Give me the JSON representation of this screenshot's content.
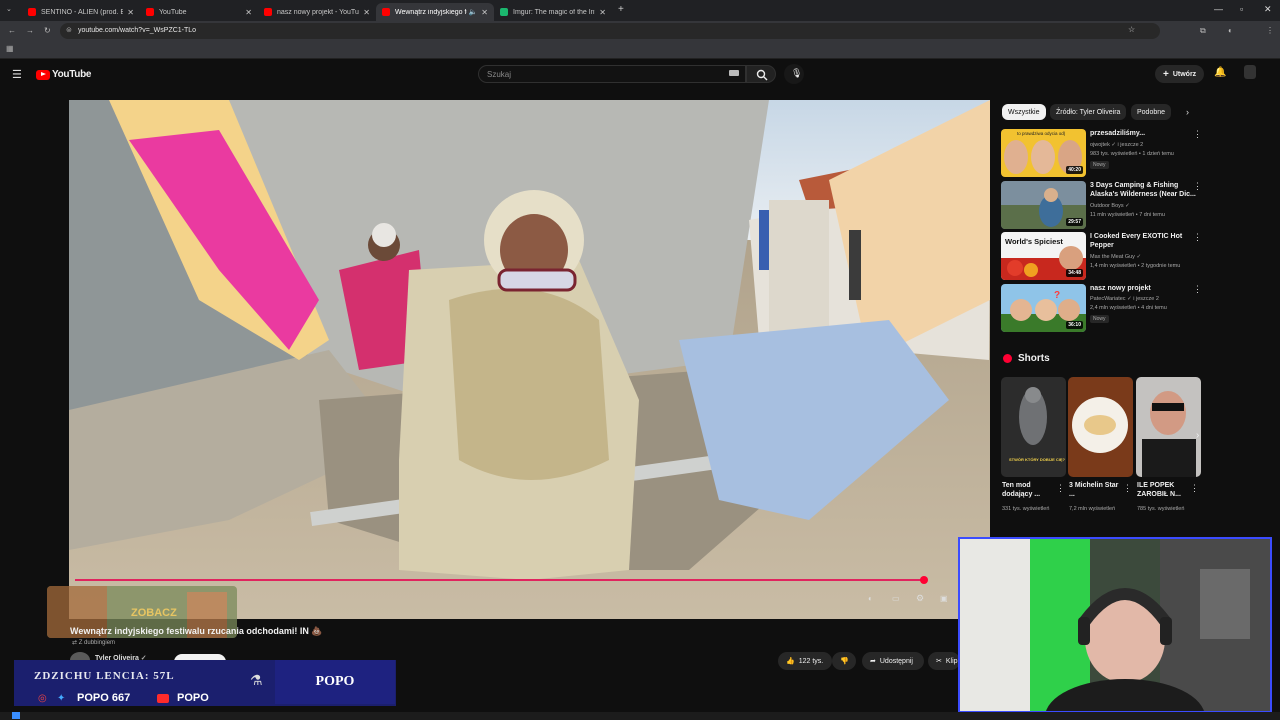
{
  "browser": {
    "tabs": [
      {
        "title": "SENTINO - ALIEN (prod. Beatha",
        "active": false,
        "favicon_color": "#ff0000"
      },
      {
        "title": "YouTube",
        "active": false,
        "favicon_color": "#ff0000"
      },
      {
        "title": "nasz nowy projekt - YouTube",
        "active": false,
        "favicon_color": "#ff0000"
      },
      {
        "title": "Wewnątrz indyjskiego festi",
        "active": true,
        "favicon_color": "#ff0000"
      },
      {
        "title": "Imgur: The magic of the Interne",
        "active": false,
        "favicon_color": "#1bb76e"
      }
    ],
    "url": "youtube.com/watch?v=_WsPZC1-TLo"
  },
  "youtube": {
    "logo_text": "YouTube",
    "search_placeholder": "Szukaj",
    "create_label": "Utwórz"
  },
  "video": {
    "title": "Wewnątrz indyjskiego festiwalu rzucania odchodami! IN 💩",
    "dubbed_note": "Z dubbingiem",
    "channel": "Tyler Oliveira",
    "likes": "122 tys.",
    "share_label": "Udostępnij",
    "clip_label": "Klip",
    "progress": 0.96
  },
  "chips": [
    "Wszystkie",
    "Źródło: Tyler Oliveira",
    "Podobne"
  ],
  "recommendations": [
    {
      "title": "przesadziliśmy...",
      "channel": "ojwojtek",
      "channel_extra": "i jeszcze 2",
      "meta": "983 tys. wyświetleń • 1 dzień temu",
      "badge": "Nowy",
      "duration": "40:20",
      "thumb_caption": "to prawdziwa odycia od)"
    },
    {
      "title": "3 Days Camping & Fishing Alaska's Wilderness (Near Dic...",
      "channel": "Outdoor Boys",
      "channel_extra": "",
      "meta": "11 mln wyświetleń • 7 dni temu",
      "badge": "",
      "duration": "29:57",
      "thumb_caption": ""
    },
    {
      "title": "I Cooked Every EXOTIC Hot Pepper",
      "channel": "Max the Meat Guy",
      "channel_extra": "",
      "meta": "1,4 mln wyświetleń • 2 tygodnie temu",
      "badge": "",
      "duration": "34:48",
      "thumb_caption": "World's Spiciest"
    },
    {
      "title": "nasz nowy projekt",
      "channel": "PatecWariatec",
      "channel_extra": "i jeszcze 2",
      "meta": "2,4 mln wyświetleń • 4 dni temu",
      "badge": "Nowy",
      "duration": "36:10",
      "thumb_caption": ""
    }
  ],
  "shorts": {
    "heading": "Shorts",
    "items": [
      {
        "title": "Ten mod dodający ...",
        "views": "331 tys. wyświetleń",
        "thumb_caption": "STWÓR KTÓRY DOBIJE CIĘ?"
      },
      {
        "title": "3 Michelin Star ...",
        "views": "7,2 mln wyświetleń",
        "thumb_caption": ""
      },
      {
        "title": "ILE POPEK ZAROBIŁ N...",
        "views": "785 tys. wyświetleń",
        "thumb_caption": ""
      }
    ]
  },
  "overlay": {
    "ticker": "ZDZICHU LENCIA: 57L",
    "popo_box": "POPO",
    "popo1": "POPO  667",
    "popo2": "POPO",
    "clip_caption": "ZOBACZ"
  },
  "colors": {
    "accent": "#ff0000",
    "progress": "#e0245e",
    "overlay_blue": "#1e2280",
    "cam_border": "#3b4cff"
  }
}
